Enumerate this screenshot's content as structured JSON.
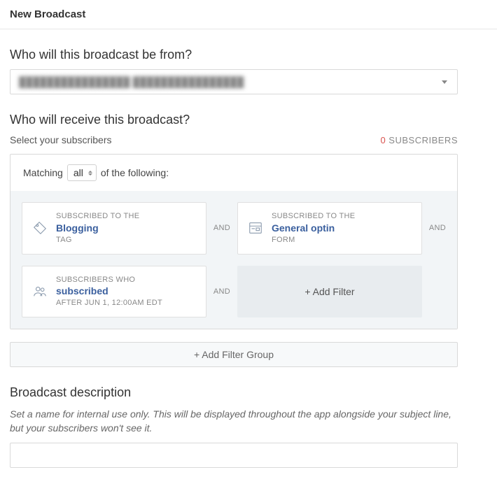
{
  "header": {
    "title": "New Broadcast"
  },
  "from": {
    "heading": "Who will this broadcast be from?",
    "selected": "████████████████ ████████████████"
  },
  "recipients": {
    "heading": "Who will receive this broadcast?",
    "subtext": "Select your subscribers",
    "count": "0",
    "count_label": "SUBSCRIBERS",
    "matching_prefix": "Matching",
    "matching_mode": "all",
    "matching_suffix": "of the following:",
    "and_label": "AND",
    "add_filter_label": "+ Add Filter",
    "add_group_label": "+ Add Filter Group",
    "filters": [
      {
        "line1": "SUBSCRIBED TO THE",
        "value": "Blogging",
        "line3": "TAG"
      },
      {
        "line1": "SUBSCRIBED TO THE",
        "value": "General optin",
        "line3": "FORM"
      },
      {
        "line1": "SUBSCRIBERS WHO",
        "value": "subscribed",
        "line3": "AFTER JUN 1, 12:00AM EDT"
      }
    ]
  },
  "description": {
    "heading": "Broadcast description",
    "hint": "Set a name for internal use only. This will be displayed throughout the app alongside your subject line, but your subscribers won't see it.",
    "value": ""
  }
}
